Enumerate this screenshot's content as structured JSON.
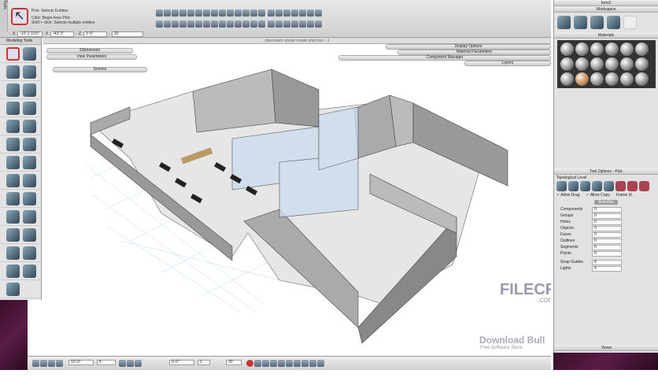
{
  "top": {
    "pick_label": "Pick: Selects Entities",
    "click_hint": "Click: Begin Area Pick",
    "shift_hint": "Shift + click: Selects multiple entities",
    "x_label": "X",
    "x_value": "-10'-2 1/16\"",
    "y_label": "Y",
    "y_value": "-43'-3\"",
    "z_label": "Z",
    "z_value": "3'-0\"",
    "angle_value": "30",
    "side_label": "Tools"
  },
  "document": {
    "title": "classroom cluster model start.tmo - 1"
  },
  "palettes": {
    "scenes": "Scenes",
    "view_parameters": "View Parameters",
    "dimension": "3Dimension",
    "display_options": "Display Options",
    "material_parameters": "Material Parameters",
    "component_manager": "Component Manager",
    "layers": "Layers"
  },
  "tools": {
    "header": "Modeling Tools"
  },
  "right": {
    "form_title": "form2",
    "workspace": "Workspace",
    "materials": "Materials",
    "tool_options": "Tool Options - Pick",
    "topological_level": "Topological Level",
    "allow_drag": "Allow Drag",
    "allow_copy": "Allow Copy",
    "frame": "Frame",
    "selection_tab": "Selection",
    "views": "Views",
    "counts": [
      {
        "label": "Components",
        "value": "0"
      },
      {
        "label": "Groups",
        "value": "0"
      },
      {
        "label": "Holes",
        "value": "0"
      },
      {
        "label": "Objects",
        "value": "0"
      },
      {
        "label": "Faces",
        "value": "0"
      },
      {
        "label": "Outlines",
        "value": "0"
      },
      {
        "label": "Segments",
        "value": "0"
      },
      {
        "label": "Points",
        "value": "0"
      },
      {
        "label": "Snap Guides",
        "value": "0"
      },
      {
        "label": "Lights",
        "value": "0"
      }
    ]
  },
  "bottom": {
    "field1": "10'-0\"",
    "field2": "5",
    "field3": "0'-0\"",
    "field4": "1",
    "field5": "30"
  },
  "watermarks": {
    "filecr": "FILECR",
    "filecr_com": ".com",
    "bull": "Download Bull",
    "bull_sub": "Free Software Store"
  }
}
